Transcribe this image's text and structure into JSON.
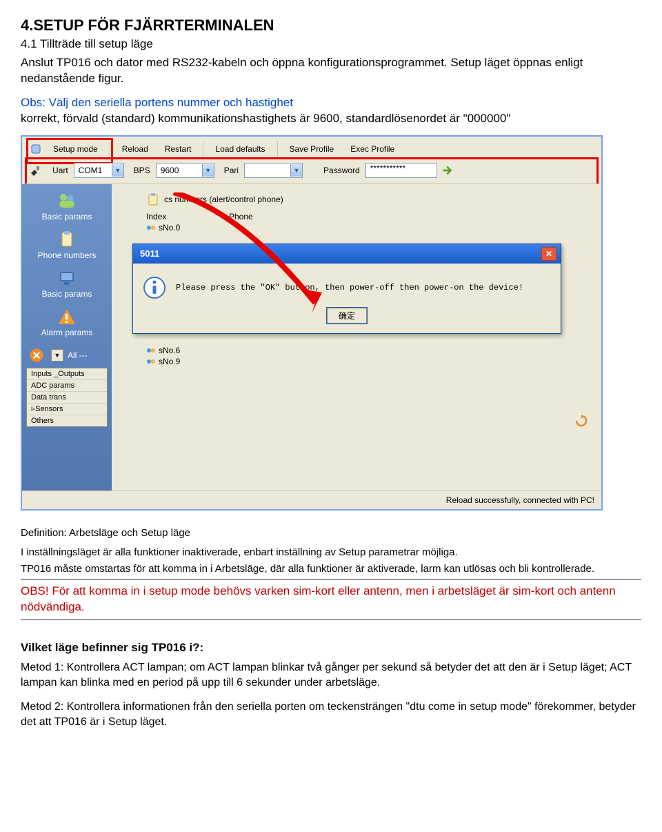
{
  "doc": {
    "h1": "4.SETUP FÖR FJÄRRTERMINALEN",
    "h2": "4.1 Tillträde till setup läge",
    "intro": "Anslut TP016 och dator med RS232-kabeln och öppna konfigurationsprogrammet. Setup läget öppnas enligt nedanstående figur.",
    "obs1a": "Obs: Välj den seriella portens nummer och hastighet",
    "obs1b": "korrekt, förvald (standard) kommunikationshastighets är 9600, standardlösenordet är \"000000\"",
    "def_t": "Definition: Arbetsläge och Setup läge",
    "def_p1": "I inställningsläget är alla funktioner inaktiverade, enbart inställning av Setup parametrar möjliga.",
    "def_p2": "TP016 måste omstartas för att komma in i Arbetsläge, där alla funktioner är aktiverade, larm kan utlösas och bli kontrollerade.",
    "warn": "OBS! För att komma in i setup mode behövs varken sim-kort eller antenn, men i arbetsläget är sim-kort och antenn nödvändiga.",
    "q": "Vilket läge befinner sig TP016 i?:",
    "m1": "Metod 1: Kontrollera ACT lampan; om ACT lampan blinkar  två gånger per sekund så betyder det att den är i Setup läget; ACT lampan kan blinka med en period på upp till 6 sekunder under arbetsläge.",
    "m2": "Metod 2: Kontrollera informationen från den seriella porten om teckensträngen  \"dtu come in setup mode\" förekommer, betyder det att TP016 är i Setup läget."
  },
  "app": {
    "toolbar": {
      "setup": "Setup mode",
      "reload": "Reload",
      "restart": "Restart",
      "defaults": "Load defaults",
      "save": "Save Profile",
      "exec": "Exec Profile"
    },
    "params": {
      "uart_l": "Uart",
      "uart_v": "COM1",
      "bps_l": "BPS",
      "bps_v": "9600",
      "pari_l": "Pari",
      "pari_v": "",
      "pw_l": "Password",
      "pw_v": "***********"
    },
    "sidebar": {
      "basic": "Basic params",
      "phone": "Phone numbers",
      "basic2": "Basic params",
      "alarm": "Alarm params",
      "all": "All ---",
      "small": {
        "io": "Inputs _Outputs",
        "adc": "ADC params",
        "data": "Data trans",
        "isens": "i-Sensors",
        "others": "Others"
      }
    },
    "content": {
      "header": "cs numbers (alert/control phone)",
      "col_index": "Index",
      "col_phone": "Phone",
      "rows": {
        "r0": "sNo.0",
        "r6": "sNo.6",
        "r9": "sNo.9"
      }
    },
    "modal": {
      "title": "5011",
      "msg": "Please press the \"OK\" button, then power-off then power-on the device!",
      "ok": "确定"
    },
    "status": "Reload successfully, connected with PC!"
  }
}
